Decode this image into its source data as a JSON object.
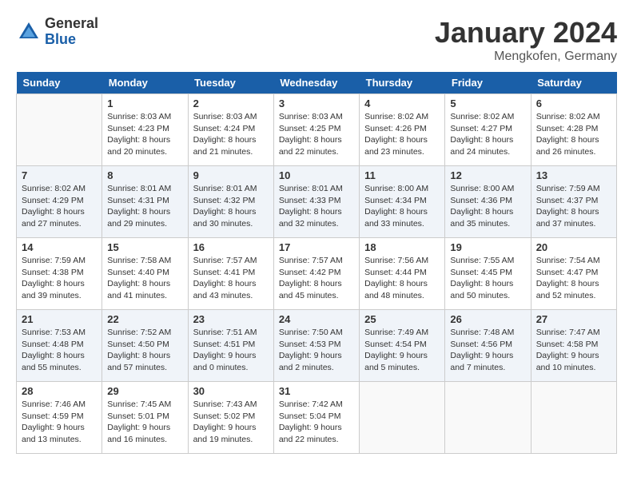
{
  "header": {
    "logo_general": "General",
    "logo_blue": "Blue",
    "month": "January 2024",
    "location": "Mengkofen, Germany"
  },
  "days_of_week": [
    "Sunday",
    "Monday",
    "Tuesday",
    "Wednesday",
    "Thursday",
    "Friday",
    "Saturday"
  ],
  "weeks": [
    [
      {
        "day": "",
        "info": ""
      },
      {
        "day": "1",
        "info": "Sunrise: 8:03 AM\nSunset: 4:23 PM\nDaylight: 8 hours\nand 20 minutes."
      },
      {
        "day": "2",
        "info": "Sunrise: 8:03 AM\nSunset: 4:24 PM\nDaylight: 8 hours\nand 21 minutes."
      },
      {
        "day": "3",
        "info": "Sunrise: 8:03 AM\nSunset: 4:25 PM\nDaylight: 8 hours\nand 22 minutes."
      },
      {
        "day": "4",
        "info": "Sunrise: 8:02 AM\nSunset: 4:26 PM\nDaylight: 8 hours\nand 23 minutes."
      },
      {
        "day": "5",
        "info": "Sunrise: 8:02 AM\nSunset: 4:27 PM\nDaylight: 8 hours\nand 24 minutes."
      },
      {
        "day": "6",
        "info": "Sunrise: 8:02 AM\nSunset: 4:28 PM\nDaylight: 8 hours\nand 26 minutes."
      }
    ],
    [
      {
        "day": "7",
        "info": "Sunrise: 8:02 AM\nSunset: 4:29 PM\nDaylight: 8 hours\nand 27 minutes."
      },
      {
        "day": "8",
        "info": "Sunrise: 8:01 AM\nSunset: 4:31 PM\nDaylight: 8 hours\nand 29 minutes."
      },
      {
        "day": "9",
        "info": "Sunrise: 8:01 AM\nSunset: 4:32 PM\nDaylight: 8 hours\nand 30 minutes."
      },
      {
        "day": "10",
        "info": "Sunrise: 8:01 AM\nSunset: 4:33 PM\nDaylight: 8 hours\nand 32 minutes."
      },
      {
        "day": "11",
        "info": "Sunrise: 8:00 AM\nSunset: 4:34 PM\nDaylight: 8 hours\nand 33 minutes."
      },
      {
        "day": "12",
        "info": "Sunrise: 8:00 AM\nSunset: 4:36 PM\nDaylight: 8 hours\nand 35 minutes."
      },
      {
        "day": "13",
        "info": "Sunrise: 7:59 AM\nSunset: 4:37 PM\nDaylight: 8 hours\nand 37 minutes."
      }
    ],
    [
      {
        "day": "14",
        "info": "Sunrise: 7:59 AM\nSunset: 4:38 PM\nDaylight: 8 hours\nand 39 minutes."
      },
      {
        "day": "15",
        "info": "Sunrise: 7:58 AM\nSunset: 4:40 PM\nDaylight: 8 hours\nand 41 minutes."
      },
      {
        "day": "16",
        "info": "Sunrise: 7:57 AM\nSunset: 4:41 PM\nDaylight: 8 hours\nand 43 minutes."
      },
      {
        "day": "17",
        "info": "Sunrise: 7:57 AM\nSunset: 4:42 PM\nDaylight: 8 hours\nand 45 minutes."
      },
      {
        "day": "18",
        "info": "Sunrise: 7:56 AM\nSunset: 4:44 PM\nDaylight: 8 hours\nand 48 minutes."
      },
      {
        "day": "19",
        "info": "Sunrise: 7:55 AM\nSunset: 4:45 PM\nDaylight: 8 hours\nand 50 minutes."
      },
      {
        "day": "20",
        "info": "Sunrise: 7:54 AM\nSunset: 4:47 PM\nDaylight: 8 hours\nand 52 minutes."
      }
    ],
    [
      {
        "day": "21",
        "info": "Sunrise: 7:53 AM\nSunset: 4:48 PM\nDaylight: 8 hours\nand 55 minutes."
      },
      {
        "day": "22",
        "info": "Sunrise: 7:52 AM\nSunset: 4:50 PM\nDaylight: 8 hours\nand 57 minutes."
      },
      {
        "day": "23",
        "info": "Sunrise: 7:51 AM\nSunset: 4:51 PM\nDaylight: 9 hours\nand 0 minutes."
      },
      {
        "day": "24",
        "info": "Sunrise: 7:50 AM\nSunset: 4:53 PM\nDaylight: 9 hours\nand 2 minutes."
      },
      {
        "day": "25",
        "info": "Sunrise: 7:49 AM\nSunset: 4:54 PM\nDaylight: 9 hours\nand 5 minutes."
      },
      {
        "day": "26",
        "info": "Sunrise: 7:48 AM\nSunset: 4:56 PM\nDaylight: 9 hours\nand 7 minutes."
      },
      {
        "day": "27",
        "info": "Sunrise: 7:47 AM\nSunset: 4:58 PM\nDaylight: 9 hours\nand 10 minutes."
      }
    ],
    [
      {
        "day": "28",
        "info": "Sunrise: 7:46 AM\nSunset: 4:59 PM\nDaylight: 9 hours\nand 13 minutes."
      },
      {
        "day": "29",
        "info": "Sunrise: 7:45 AM\nSunset: 5:01 PM\nDaylight: 9 hours\nand 16 minutes."
      },
      {
        "day": "30",
        "info": "Sunrise: 7:43 AM\nSunset: 5:02 PM\nDaylight: 9 hours\nand 19 minutes."
      },
      {
        "day": "31",
        "info": "Sunrise: 7:42 AM\nSunset: 5:04 PM\nDaylight: 9 hours\nand 22 minutes."
      },
      {
        "day": "",
        "info": ""
      },
      {
        "day": "",
        "info": ""
      },
      {
        "day": "",
        "info": ""
      }
    ]
  ]
}
